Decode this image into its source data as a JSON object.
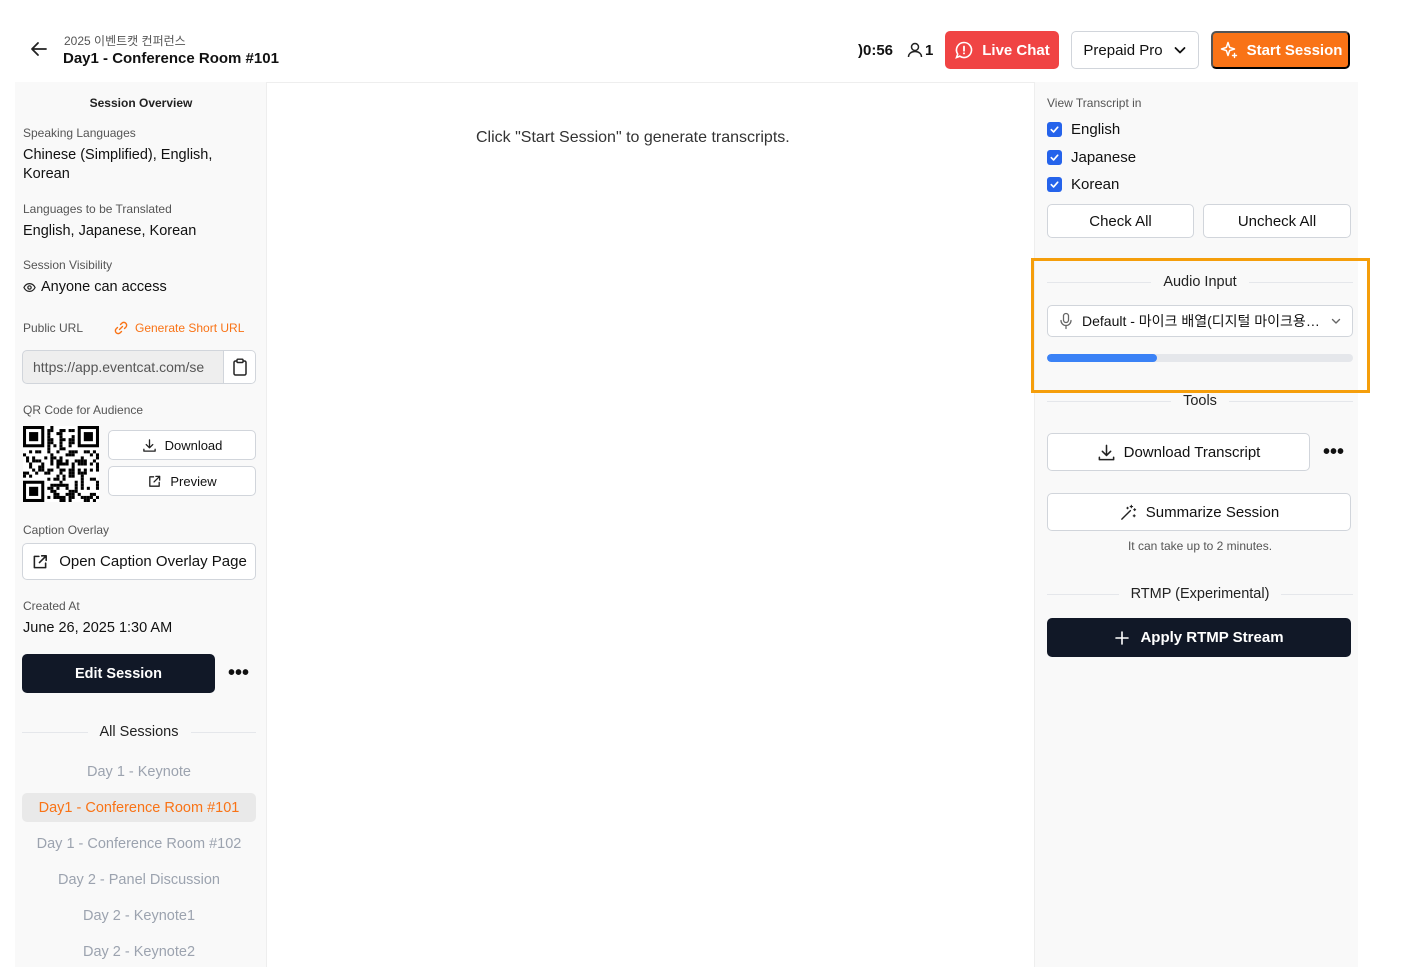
{
  "header": {
    "event_name": "2025 이벤트캣 컨퍼런스",
    "session_title": "Day1 - Conference Room #101",
    "timer": ")0:56",
    "viewer_count": "1",
    "live_chat_label": "Live Chat",
    "plan_label": "Prepaid Pro",
    "start_session_label": "Start Session"
  },
  "left": {
    "overview_title": "Session Overview",
    "speaking_languages_label": "Speaking Languages",
    "speaking_languages_line1": "Chinese (Simplified), English,",
    "speaking_languages_line2": "Korean",
    "translated_label": "Languages to be Translated",
    "translated_value": "English, Japanese, Korean",
    "visibility_label": "Session Visibility",
    "visibility_value": "Anyone can access",
    "public_url_label": "Public URL",
    "generate_short_url": "Generate Short URL",
    "public_url_value": "https://app.eventcat.com/se",
    "qr_label": "QR Code for Audience",
    "download_label": "Download",
    "preview_label": "Preview",
    "caption_overlay_label": "Caption Overlay",
    "open_overlay_label": "Open Caption Overlay Page",
    "created_at_label": "Created At",
    "created_at_value": "June 26, 2025 1:30 AM",
    "edit_session_label": "Edit Session",
    "all_sessions_label": "All Sessions",
    "sessions": [
      "Day 1 - Keynote",
      "Day1 - Conference Room #101",
      "Day 1 - Conference Room #102",
      "Day 2 - Panel Discussion",
      "Day 2 - Keynote1",
      "Day 2 - Keynote2"
    ],
    "active_session_index": 1
  },
  "center": {
    "message": "Click \"Start Session\" to generate transcripts."
  },
  "right": {
    "view_transcript_label": "View Transcript in",
    "languages": [
      {
        "name": "English",
        "checked": true
      },
      {
        "name": "Japanese",
        "checked": true
      },
      {
        "name": "Korean",
        "checked": true
      }
    ],
    "check_all_label": "Check All",
    "uncheck_all_label": "Uncheck All",
    "audio_input_label": "Audio Input",
    "audio_device": "Default - 마이크 배열(디지털 마이크용 인텔® 스마트 사운드 기술)",
    "audio_level_fraction": 0.36,
    "tools_label": "Tools",
    "download_transcript_label": "Download Transcript",
    "summarize_label": "Summarize Session",
    "summarize_note": "It can take up to 2 minutes.",
    "rtmp_label": "RTMP (Experimental)",
    "apply_rtmp_label": "Apply RTMP Stream"
  },
  "colors": {
    "accent_orange": "#f97316",
    "live_red": "#f04444",
    "dark": "#111827",
    "checkbox_blue": "#2563eb",
    "highlight": "#f59e0b"
  },
  "icons": [
    "back-arrow-icon",
    "user-icon",
    "chat-alert-icon",
    "chevron-down-icon",
    "sparkle-icon",
    "eye-icon",
    "link-icon",
    "clipboard-icon",
    "download-icon",
    "external-link-icon",
    "microphone-icon",
    "magic-wand-icon",
    "plus-icon",
    "more-dots-icon",
    "check-icon"
  ]
}
